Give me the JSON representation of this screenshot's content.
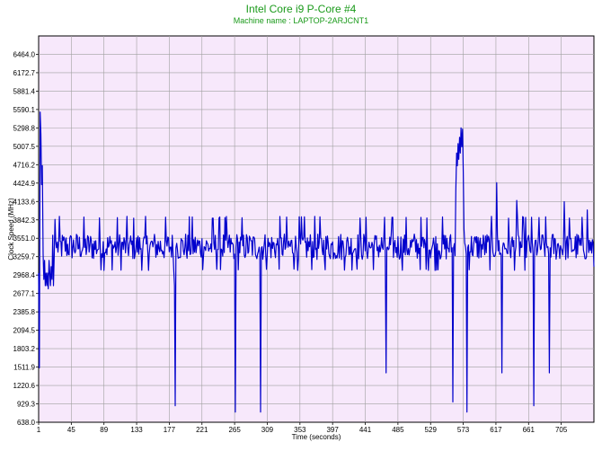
{
  "chart_data": {
    "type": "line",
    "title": "Intel Core i9 P-Core #4",
    "subtitle": "Machine name : LAPTOP-2ARJCNT1",
    "xlabel": "Time (seconds)",
    "ylabel": "Clock Speed (MHz)",
    "xlim": [
      1,
      749
    ],
    "ylim": [
      638.0,
      6755.0
    ],
    "x_ticks": [
      1,
      45,
      89,
      133,
      177,
      221,
      265,
      309,
      353,
      397,
      441,
      485,
      529,
      573,
      617,
      661,
      705
    ],
    "y_ticks": [
      638.0,
      929.3,
      1220.6,
      1511.9,
      1803.2,
      2094.5,
      2385.8,
      2677.1,
      2968.4,
      3259.7,
      3551.0,
      3842.3,
      4133.6,
      4424.9,
      4716.2,
      5007.5,
      5298.8,
      5590.1,
      5881.4,
      6172.7,
      6464.0
    ],
    "x_tick_labels": [
      "1",
      "45",
      "89",
      "133",
      "177",
      "221",
      "265",
      "309",
      "353",
      "397",
      "441",
      "485",
      "529",
      "573",
      "617",
      "661",
      "705"
    ],
    "y_tick_labels": [
      "638.0",
      "929.3",
      "1220.6",
      "1511.9",
      "1803.2",
      "2094.5",
      "2385.8",
      "2677.1",
      "2968.4",
      "3259.7",
      "3551.0",
      "3842.3",
      "4133.6",
      "4424.9",
      "4716.2",
      "5007.5",
      "5298.8",
      "5590.1",
      "5881.4",
      "6172.7",
      "6464.0"
    ],
    "grid": true,
    "series": [
      {
        "name": "",
        "color": "#0000cc",
        "baseline": 3420,
        "noise_amplitude": 230,
        "early_points": [
          [
            1,
            3000
          ],
          [
            2,
            1500
          ],
          [
            3,
            5550
          ],
          [
            4,
            5200
          ],
          [
            5,
            4400
          ],
          [
            6,
            4700
          ],
          [
            7,
            3300
          ],
          [
            8,
            2900
          ],
          [
            9,
            3200
          ],
          [
            10,
            2800
          ],
          [
            11,
            3000
          ],
          [
            12,
            2800
          ],
          [
            13,
            3000
          ],
          [
            14,
            2750
          ],
          [
            15,
            3200
          ],
          [
            16,
            3000
          ],
          [
            17,
            2800
          ],
          [
            18,
            3100
          ],
          [
            19,
            2900
          ],
          [
            20,
            3600
          ],
          [
            21,
            2800
          ],
          [
            22,
            3300
          ],
          [
            23,
            3850
          ],
          [
            24,
            3500
          ],
          [
            25,
            3400
          ]
        ],
        "dips": [
          [
            184,
            2800
          ],
          [
            185,
            900
          ],
          [
            186,
            3400
          ],
          [
            265,
            3300
          ],
          [
            266,
            800
          ],
          [
            267,
            3400
          ],
          [
            299,
            3300
          ],
          [
            300,
            800
          ],
          [
            301,
            3400
          ],
          [
            468,
            3300
          ],
          [
            469,
            1420
          ],
          [
            470,
            3400
          ],
          [
            558,
            3400
          ],
          [
            559,
            960
          ],
          [
            560,
            3400
          ],
          [
            577,
            3300
          ],
          [
            578,
            800
          ],
          [
            579,
            3400
          ],
          [
            624,
            3300
          ],
          [
            625,
            1420
          ],
          [
            626,
            3400
          ],
          [
            667,
            3300
          ],
          [
            668,
            900
          ],
          [
            669,
            3400
          ],
          [
            688,
            3300
          ],
          [
            689,
            1420
          ],
          [
            690,
            3400
          ]
        ],
        "spikes": [
          [
            563,
            4300
          ],
          [
            564,
            4900
          ],
          [
            565,
            4700
          ],
          [
            566,
            5050
          ],
          [
            567,
            4800
          ],
          [
            568,
            5150
          ],
          [
            569,
            4900
          ],
          [
            570,
            5300
          ],
          [
            571,
            5000
          ],
          [
            572,
            5280
          ],
          [
            573,
            4600
          ],
          [
            574,
            3700
          ],
          [
            618,
            4430
          ],
          [
            645,
            4150
          ],
          [
            709,
            4130
          ],
          [
            740,
            4000
          ],
          [
            749,
            3100
          ]
        ]
      }
    ]
  }
}
